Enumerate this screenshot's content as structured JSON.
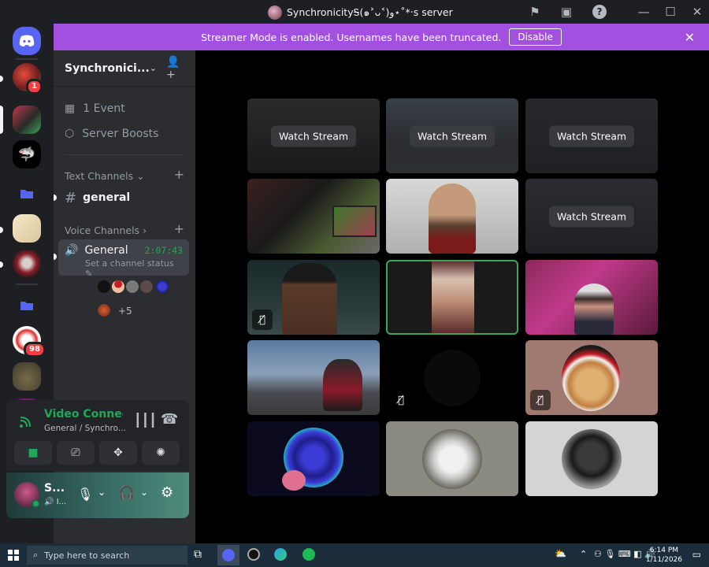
{
  "window": {
    "title": "SynchronicityᎦ(๑˃ᴗ˂)ﻭ⋆˚*‧s server"
  },
  "banner": {
    "text": "Streamer Mode is enabled. Usernames have been truncated.",
    "disable_label": "Disable"
  },
  "server": {
    "name": "Synchronici..."
  },
  "server_rail": {
    "badges": [
      "1",
      "98"
    ]
  },
  "sidebar": {
    "events": "1 Event",
    "boosts": "Server Boosts",
    "text_category": "Text Channels",
    "text_channel": "general",
    "voice_category": "Voice Channels",
    "voice_channel": "General",
    "voice_time": "2:07:43",
    "voice_status": "Set a channel status",
    "more_users": "+5"
  },
  "voice_panel": {
    "status": "Video Connected",
    "location": "General / Synchro..."
  },
  "user_panel": {
    "name": "S...",
    "sub": "I..."
  },
  "stage": {
    "watch_label": "Watch Stream"
  },
  "taskbar": {
    "search_placeholder": "Type here to search",
    "time": "6:14 PM",
    "date": "1/11/2026"
  },
  "colors": {
    "banner": "#a350e0",
    "accent_green": "#23a55a",
    "badge_red": "#f23f43",
    "speaking_outline": "#3ba55d"
  }
}
